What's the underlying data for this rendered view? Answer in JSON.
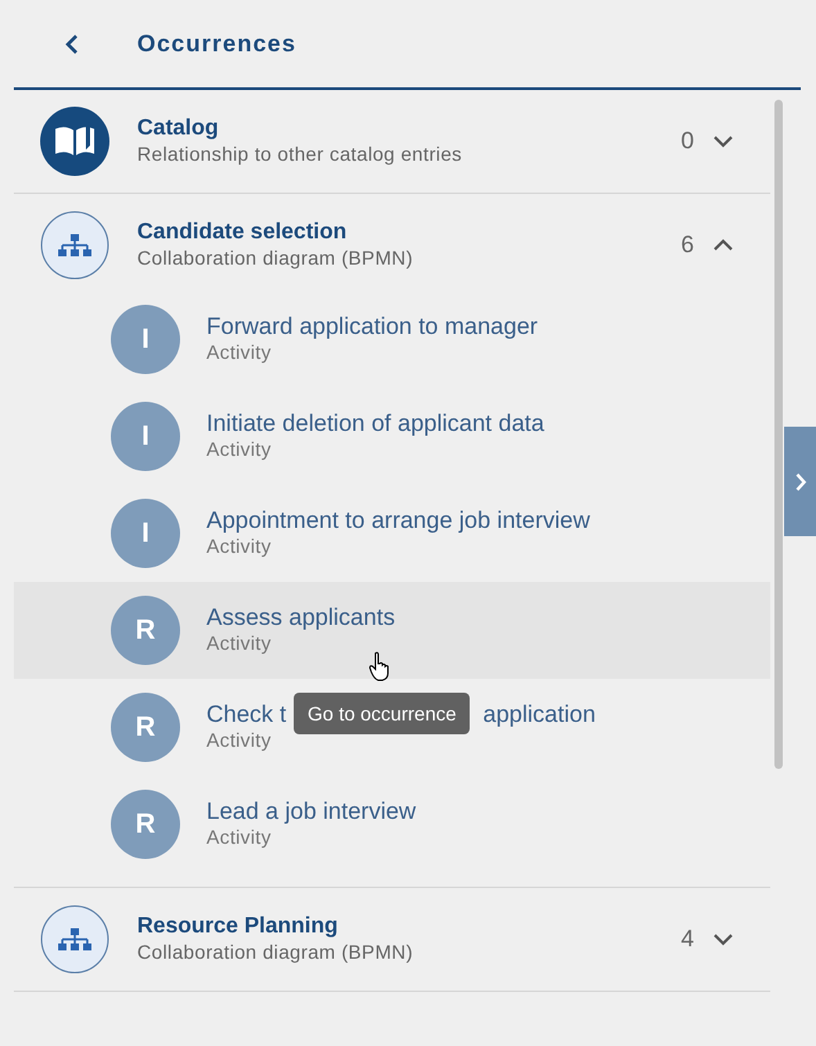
{
  "header": {
    "title": "Occurrences"
  },
  "groups": [
    {
      "kind": "catalog",
      "title": "Catalog",
      "subtitle": "Relationship to other catalog entries",
      "count": "0",
      "expanded": false
    },
    {
      "kind": "diagram",
      "title": "Candidate selection",
      "subtitle": "Collaboration diagram (BPMN)",
      "count": "6",
      "expanded": true,
      "items": [
        {
          "letter": "I",
          "title": "Forward application to manager",
          "subtitle": "Activity",
          "hovered": false
        },
        {
          "letter": "I",
          "title": "Initiate deletion of applicant data",
          "subtitle": "Activity",
          "hovered": false
        },
        {
          "letter": "I",
          "title": "Appointment to arrange job interview",
          "subtitle": "Activity",
          "hovered": false
        },
        {
          "letter": "R",
          "title": "Assess applicants",
          "subtitle": "Activity",
          "hovered": true
        },
        {
          "letter": "R",
          "title": "Check t",
          "title_end": "application",
          "subtitle": "Activity",
          "hovered": false,
          "tooltip": "Go to occurrence"
        },
        {
          "letter": "R",
          "title": "Lead a job interview",
          "subtitle": "Activity",
          "hovered": false
        }
      ]
    },
    {
      "kind": "diagram",
      "title": "Resource Planning",
      "subtitle": "Collaboration diagram (BPMN)",
      "count": "4",
      "expanded": false
    }
  ]
}
